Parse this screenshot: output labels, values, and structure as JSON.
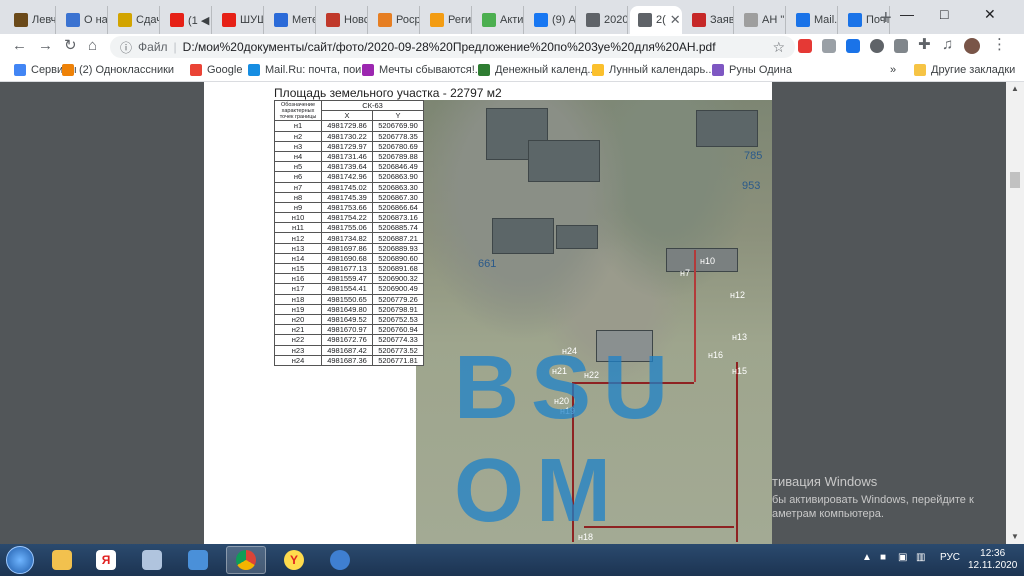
{
  "tabs": [
    {
      "label": "Левч",
      "color": "#6b4a1a"
    },
    {
      "label": "О на",
      "color": "#3b73d1"
    },
    {
      "label": "Сдач",
      "color": "#d2a400"
    },
    {
      "label": "(1 ◀",
      "color": "#e62117"
    },
    {
      "label": "ШУШ",
      "color": "#e62117"
    },
    {
      "label": "Мете",
      "color": "#2a6ad8"
    },
    {
      "label": "Новс",
      "color": "#c0392b"
    },
    {
      "label": "Росрс",
      "color": "#e67e22"
    },
    {
      "label": "Реги",
      "color": "#f39c12"
    },
    {
      "label": "Акти",
      "color": "#4caf50"
    },
    {
      "label": "(9) А",
      "color": "#1877f2"
    },
    {
      "label": "2020",
      "color": "#5f6368"
    },
    {
      "label": "2(",
      "color": "#5f6368",
      "active": true
    },
    {
      "label": "Заяв",
      "color": "#c62828"
    },
    {
      "label": "АН \"",
      "color": "#9e9e9e"
    },
    {
      "label": "Mail.",
      "color": "#1a73e8"
    },
    {
      "label": "Почт",
      "color": "#1a73e8"
    }
  ],
  "new_tab": "+",
  "window": {
    "minimize": "—",
    "maximize": "□",
    "close": "✕"
  },
  "address": {
    "info": "ⓘ",
    "scheme": "Файл",
    "url": "D:/мои%20документы/сайт/фото/2020-09-28%20Предложение%20по%203уе%20для%20АН.pdf"
  },
  "bookmarks": [
    {
      "label": "Сервисы",
      "color": "#4285f4"
    },
    {
      "label": "(2) Одноклассники",
      "color": "#ee8208"
    },
    {
      "label": "Google",
      "color": "#ea4335"
    },
    {
      "label": "Mail.Ru: почта, пои...",
      "color": "#168de2"
    },
    {
      "label": "Мечты сбываются!...",
      "color": "#9c27b0"
    },
    {
      "label": "Денежный календ...",
      "color": "#2e7d32"
    },
    {
      "label": "Лунный календарь...",
      "color": "#fbc02d"
    },
    {
      "label": "Руны Одина",
      "color": "#7e57c2"
    }
  ],
  "bookmarks_more": "»",
  "bookmarks_other": "Другие закладки",
  "pdf": {
    "title": "Площадь земельного участка - 22797 м2",
    "table": {
      "header_point": "Обозначение характерных точек границы",
      "header_system": "СК-63",
      "header_x": "X",
      "header_y": "Y",
      "rows": [
        {
          "pt": "н1",
          "x": "4981729.86",
          "y": "5206769.90"
        },
        {
          "pt": "н2",
          "x": "4981730.22",
          "y": "5206778.35"
        },
        {
          "pt": "н3",
          "x": "4981729.97",
          "y": "5206780.69"
        },
        {
          "pt": "н4",
          "x": "4981731.46",
          "y": "5206789.88"
        },
        {
          "pt": "н5",
          "x": "4981739.64",
          "y": "5206846.49"
        },
        {
          "pt": "н6",
          "x": "4981742.96",
          "y": "5206863.90"
        },
        {
          "pt": "н7",
          "x": "4981745.02",
          "y": "5206863.30"
        },
        {
          "pt": "н8",
          "x": "4981745.39",
          "y": "5206867.30"
        },
        {
          "pt": "н9",
          "x": "4981753.66",
          "y": "5206866.64"
        },
        {
          "pt": "н10",
          "x": "4981754.22",
          "y": "5206873.16"
        },
        {
          "pt": "н11",
          "x": "4981755.06",
          "y": "5206885.74"
        },
        {
          "pt": "н12",
          "x": "4981734.82",
          "y": "5206887.21"
        },
        {
          "pt": "н13",
          "x": "4981697.86",
          "y": "5206889.93"
        },
        {
          "pt": "н14",
          "x": "4981690.68",
          "y": "5206890.60"
        },
        {
          "pt": "н15",
          "x": "4981677.13",
          "y": "5206891.68"
        },
        {
          "pt": "н16",
          "x": "4981559.47",
          "y": "5206900.32"
        },
        {
          "pt": "н17",
          "x": "4981554.41",
          "y": "5206900.49"
        },
        {
          "pt": "н18",
          "x": "4981550.65",
          "y": "5206779.26"
        },
        {
          "pt": "н19",
          "x": "4981649.80",
          "y": "5206798.91"
        },
        {
          "pt": "н20",
          "x": "4981649.52",
          "y": "5206752.53"
        },
        {
          "pt": "н21",
          "x": "4981670.97",
          "y": "5206760.94"
        },
        {
          "pt": "н22",
          "x": "4981672.76",
          "y": "5206774.33"
        },
        {
          "pt": "н23",
          "x": "4981687.42",
          "y": "5206773.52"
        },
        {
          "pt": "н24",
          "x": "4981687.36",
          "y": "5206771.81"
        }
      ]
    },
    "map_labels": {
      "p661": "661",
      "p785": "785",
      "p953": "953",
      "n7": "н7",
      "n10": "н10",
      "n12": "н12",
      "n13": "н13",
      "n16": "н16",
      "n15": "н15",
      "n21": "н21",
      "n22": "н22",
      "n20": "н20",
      "n19": "н19",
      "n18": "н18",
      "n24": "н24"
    },
    "watermark": "BSU   OM"
  },
  "activation": {
    "title": "тивация Windows",
    "line1": "бы активировать Windows, перейдите к",
    "line2": "аметрам компьютера."
  },
  "taskbar": {
    "lang": "РУС",
    "time": "12:36",
    "date": "12.11.2020"
  }
}
